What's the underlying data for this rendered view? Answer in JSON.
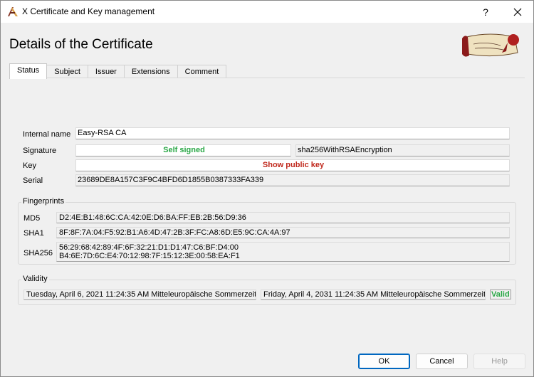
{
  "window": {
    "title": "X Certificate and Key management",
    "help_glyph": "?"
  },
  "header": {
    "page_title": "Details of the Certificate"
  },
  "tabs": [
    {
      "label": "Status",
      "active": true
    },
    {
      "label": "Subject",
      "active": false
    },
    {
      "label": "Issuer",
      "active": false
    },
    {
      "label": "Extensions",
      "active": false
    },
    {
      "label": "Comment",
      "active": false
    }
  ],
  "status": {
    "internal_name_label": "Internal name",
    "internal_name_value": "Easy-RSA CA",
    "signature_label": "Signature",
    "signature_status": "Self signed",
    "signature_algorithm": "sha256WithRSAEncryption",
    "key_label": "Key",
    "key_action": "Show public key",
    "serial_label": "Serial",
    "serial_value": "23689DE8A157C3F9C4BFD6D1855B0387333FA339"
  },
  "fingerprints": {
    "title": "Fingerprints",
    "md5_label": "MD5",
    "md5_value": "D2:4E:B1:48:6C:CA:42:0E:D6:BA:FF:EB:2B:56:D9:36",
    "sha1_label": "SHA1",
    "sha1_value": "8F:8F:7A:04:F5:92:B1:A6:4D:47:2B:3F:FC:A8:6D:E5:9C:CA:4A:97",
    "sha256_label": "SHA256",
    "sha256_line1": "56:29:68:42:89:4F:6F:32:21:D1:D1:47:C6:BF:D4:00",
    "sha256_line2": "B4:6E:7D:6C:E4:70:12:98:7F:15:12:3E:00:58:EA:F1"
  },
  "validity": {
    "title": "Validity",
    "not_before": "Tuesday, April 6, 2021 11:24:35 AM Mitteleuropäische Sommerzeit",
    "not_after": "Friday, April 4, 2031 11:24:35 AM Mitteleuropäische Sommerzeit",
    "state": "Valid"
  },
  "buttons": {
    "ok": "OK",
    "cancel": "Cancel",
    "help": "Help"
  },
  "colors": {
    "ok_green": "#28a745",
    "warning_red": "#c0281c",
    "default_button_blue": "#0067c0"
  },
  "icons": {
    "app": "xca-app-icon",
    "logo": "scroll-seal-logo",
    "close": "close-icon"
  }
}
